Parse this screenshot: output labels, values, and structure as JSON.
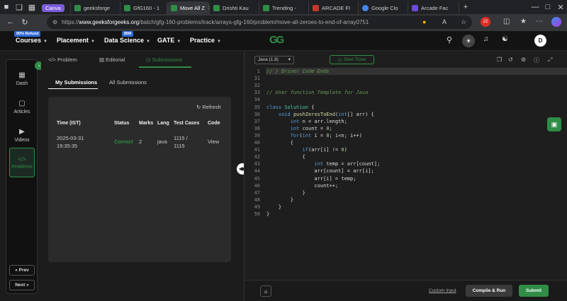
{
  "browser": {
    "tabs": [
      {
        "label": "Canva",
        "color": "#7d5bdc"
      },
      {
        "label": "geeksforge",
        "color": "#2f8d46"
      },
      {
        "label": "GfG160 - 1",
        "color": "#2f8d46"
      },
      {
        "label": "Move All Z",
        "color": "#2f8d46"
      },
      {
        "label": "Drishti Kau",
        "color": "#2f8d46"
      },
      {
        "label": "Trending -",
        "color": "#2f8d46"
      },
      {
        "label": "ARCADE FI",
        "color": "#c0392b"
      },
      {
        "label": "Google Clo",
        "color": "#4285f4"
      },
      {
        "label": "Arcade Fac",
        "color": "#6a4cd8"
      }
    ],
    "url_prefix": "https://",
    "url_host": "www.geeksforgeeks.org",
    "url_path": "/batch/gfg-160-problems/track/arrays-gfg-160/problem/move-all-zeroes-to-end-of-array0751"
  },
  "header": {
    "courses": "Courses",
    "courses_tag": "90% Refund",
    "placement": "Placement",
    "data_science": "Data Science",
    "data_science_tag": "IBM",
    "gate": "GATE",
    "practice": "Practice",
    "logo": "GG",
    "avatar": "D"
  },
  "rail": {
    "items": [
      {
        "label": "Dash",
        "icon": "▦"
      },
      {
        "label": "Articles",
        "icon": "▢"
      },
      {
        "label": "Videos",
        "icon": "▶"
      },
      {
        "label": "Problems",
        "icon": "</>"
      }
    ],
    "prev": "« Prev",
    "next": "Next »"
  },
  "problem_tabs": {
    "problem": "Problem",
    "editorial": "Editorial",
    "submissions": "Submissions"
  },
  "submissions": {
    "my": "My Submissions",
    "all": "All Submissions",
    "refresh": "Refresh",
    "headers": [
      "Time (IST)",
      "Status",
      "Marks",
      "Lang",
      "Test Cases",
      "Code"
    ],
    "row": {
      "date": "2025-03-31",
      "time": "19:35:35",
      "status": "Correct",
      "marks": "2",
      "lang": "java",
      "tests_a": "1115 /",
      "tests_b": "1115",
      "code": "View"
    }
  },
  "editor": {
    "language": "Java (1.8)",
    "start_timer": "Start Timer",
    "lines": [
      {
        "n": "1",
        "html": "<span class='cm'>// }</span> <span class='cm'>Driver Code Ends</span>"
      },
      {
        "n": "31",
        "html": ""
      },
      {
        "n": "32",
        "html": ""
      },
      {
        "n": "33",
        "html": "<span class='cm'>// User function Template for Java</span>"
      },
      {
        "n": "34",
        "html": ""
      },
      {
        "n": "35",
        "html": "<span class='kw'>class</span> <span class='ty'>Solution</span> {"
      },
      {
        "n": "36",
        "html": "    <span class='kw'>void</span> <span class='fn'>pushZerosToEnd</span>(<span class='kw'>int</span>[] arr) {"
      },
      {
        "n": "37",
        "html": "        <span class='kw'>int</span> n = arr.length;"
      },
      {
        "n": "38",
        "html": "        <span class='kw'>int</span> count = <span class='num'>0</span>;"
      },
      {
        "n": "39",
        "html": "        <span class='kw'>for</span>(<span class='kw'>int</span> i = <span class='num'>0</span>; i&lt;n; i++)"
      },
      {
        "n": "40",
        "html": "        {"
      },
      {
        "n": "41",
        "html": "            <span class='kw'>if</span>(arr[i] != <span class='num'>0</span>)"
      },
      {
        "n": "42",
        "html": "            {"
      },
      {
        "n": "43",
        "html": "                <span class='kw'>int</span> temp = arr[count];"
      },
      {
        "n": "44",
        "html": "                arr[count] = arr[i];"
      },
      {
        "n": "45",
        "html": "                arr[i] = temp;"
      },
      {
        "n": "46",
        "html": "                count++;"
      },
      {
        "n": "47",
        "html": "            }"
      },
      {
        "n": "48",
        "html": "        }"
      },
      {
        "n": "49",
        "html": "    }"
      },
      {
        "n": "50",
        "html": "}"
      }
    ],
    "custom_input": "Custom Input",
    "compile_run": "Compile & Run",
    "submit": "Submit"
  },
  "colors": {
    "accent": "#2f8d46",
    "editor_bg": "#1e1e1e"
  }
}
